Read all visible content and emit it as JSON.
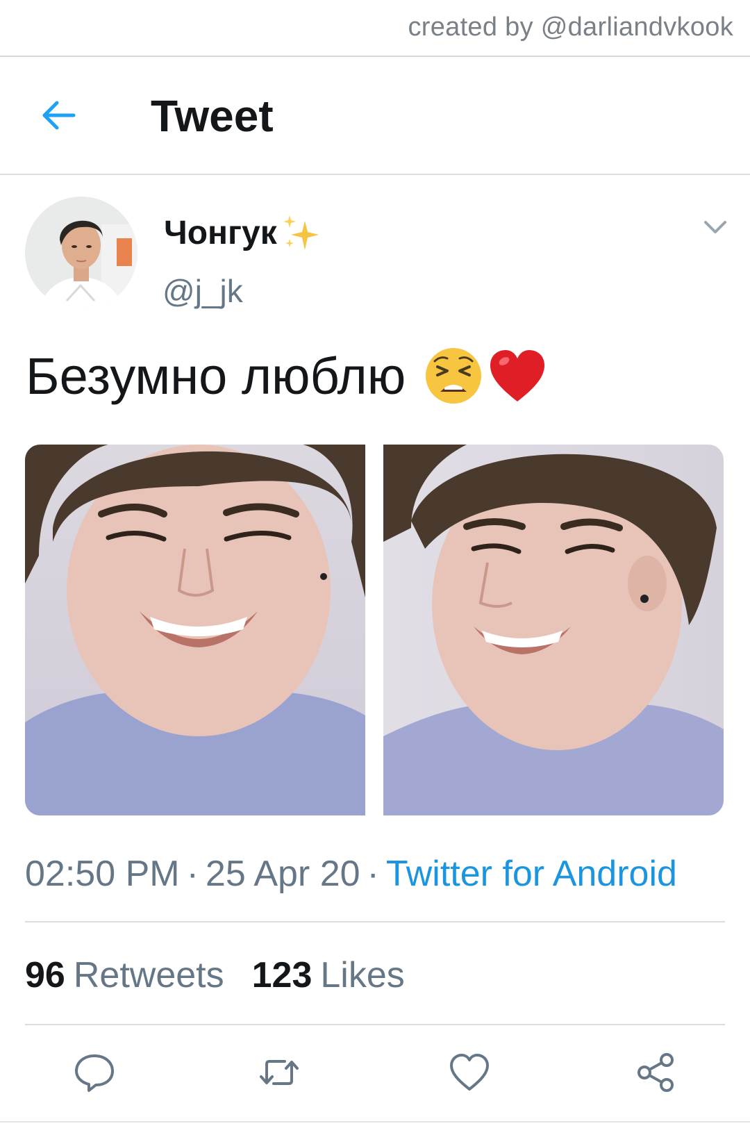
{
  "credit": {
    "text": "created by @darliandvkook"
  },
  "header": {
    "title": "Tweet",
    "back_icon": "arrow-left-icon"
  },
  "author": {
    "display_name": "Чонгук",
    "handle": "@j_jk",
    "name_emoji": "sparkles-icon"
  },
  "tweet": {
    "text": "Безумно люблю",
    "emojis": [
      "tired-face-emoji",
      "red-heart-emoji"
    ]
  },
  "media": [
    {
      "alt": "photo-1"
    },
    {
      "alt": "photo-2"
    }
  ],
  "meta": {
    "time": "02:50 PM",
    "separator": "·",
    "date": "25 Apr 20",
    "source": "Twitter for Android"
  },
  "stats": {
    "retweets_count": "96",
    "retweets_label": "Retweets",
    "likes_count": "123",
    "likes_label": "Likes"
  },
  "colors": {
    "accent": "#1b95e0",
    "text_primary": "#14171a",
    "text_secondary": "#657786",
    "divider": "#d9dce0"
  }
}
